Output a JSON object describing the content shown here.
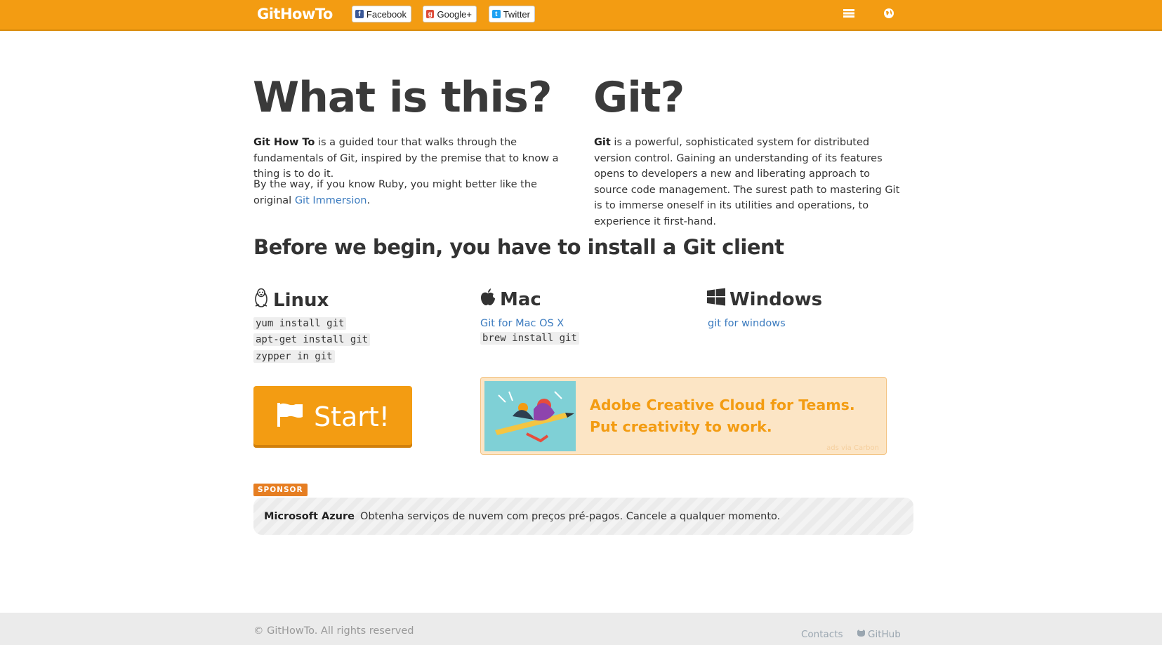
{
  "header": {
    "brand": "GitHowTo",
    "share": {
      "facebook": "Facebook",
      "google": "Google+",
      "twitter": "Twitter"
    }
  },
  "intro": {
    "title": "What is this?",
    "p1_bold": "Git How To",
    "p1_rest": " is a guided tour that walks through the fundamentals of Git, inspired by the premise that to know a thing is to do it.",
    "p2_text": "By the way, if you know Ruby, you might better like the original ",
    "p2_link": "Git Immersion",
    "p2_end": "."
  },
  "git": {
    "title": "Git?",
    "bold": "Git",
    "text": " is a powerful, sophisticated system for distributed version control. Gaining an understanding of its features opens to developers a new and liberating approach to source code management. The surest path to mastering Git is to immerse oneself in its utilities and operations, to experience it first-hand."
  },
  "install": {
    "heading": "Before we begin, you have to install a Git client",
    "linux": {
      "title": "Linux",
      "commands": [
        "yum install git",
        "apt-get install git",
        "zypper in git"
      ]
    },
    "mac": {
      "title": "Mac",
      "link": "Git for Mac OS X",
      "command": "brew install git"
    },
    "windows": {
      "title": "Windows",
      "link": "git for windows"
    }
  },
  "start_button": "Start!",
  "ad": {
    "text": "Adobe Creative Cloud for Teams. Put creativity to work.",
    "credit": "ads via Carbon"
  },
  "sponsor": {
    "badge": "SPONSOR",
    "name": "Microsoft Azure",
    "text": "Obtenha serviços de nuvem com preços pré-pagos. Cancele a qualquer momento."
  },
  "footer": {
    "copyright": "© GitHowTo. All rights reserved",
    "contacts": "Contacts",
    "github": "GitHub"
  },
  "colors": {
    "accent": "#f39c12",
    "link": "#3b7bbf",
    "ad_bg": "#fce5c5"
  }
}
